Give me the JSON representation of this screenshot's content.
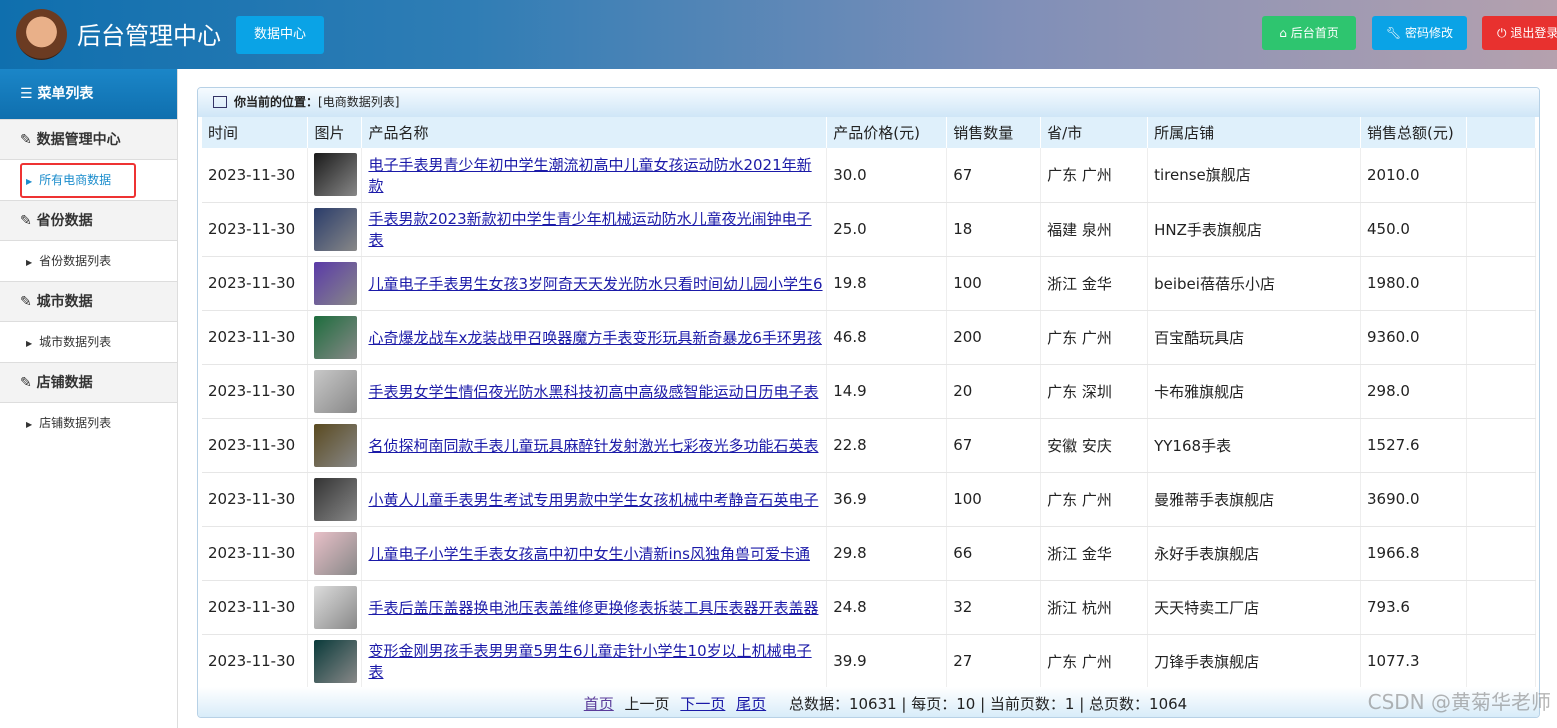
{
  "header": {
    "title": "后台管理中心",
    "data_center": "数据中心",
    "buttons": [
      {
        "label": "后台首页",
        "icon": "home-icon",
        "color": "#2ec56f"
      },
      {
        "label": "密码修改",
        "icon": "wrench-icon",
        "color": "#0aa3e6"
      },
      {
        "label": "退出登录",
        "icon": "power-icon",
        "color": "#e8312f"
      }
    ]
  },
  "sidebar": {
    "title": "菜单列表",
    "groups": [
      {
        "label": "数据管理中心",
        "item": "所有电商数据"
      },
      {
        "label": "省份数据",
        "item": "省份数据列表"
      },
      {
        "label": "城市数据",
        "item": "城市数据列表"
      },
      {
        "label": "店铺数据",
        "item": "店铺数据列表"
      }
    ]
  },
  "breadcrumb": {
    "label": "你当前的位置：",
    "value": "[电商数据列表]"
  },
  "table": {
    "columns": [
      "时间",
      "图片",
      "产品名称",
      "产品价格(元)",
      "销售数量",
      "省/市",
      "所属店铺",
      "销售总额(元)"
    ],
    "rows": [
      [
        "2023-11-30",
        "电子手表男青少年初中学生潮流初高中儿童女孩运动防水2021年新款",
        "30.0",
        "67",
        "广东 广州",
        "tirense旗舰店",
        "2010.0"
      ],
      [
        "2023-11-30",
        "手表男款2023新款初中学生青少年机械运动防水儿童夜光闹钟电子表",
        "25.0",
        "18",
        "福建 泉州",
        "HNZ手表旗舰店",
        "450.0"
      ],
      [
        "2023-11-30",
        "儿童电子手表男生女孩3岁阿奇天天发光防水只看时间幼儿园小学生6",
        "19.8",
        "100",
        "浙江 金华",
        "beibei蓓蓓乐小店",
        "1980.0"
      ],
      [
        "2023-11-30",
        "心奇爆龙战车x龙装战甲召唤器魔方手表变形玩具新奇暴龙6手环男孩",
        "46.8",
        "200",
        "广东 广州",
        "百宝酷玩具店",
        "9360.0"
      ],
      [
        "2023-11-30",
        "手表男女学生情侣夜光防水黑科技初高中高级感智能运动日历电子表",
        "14.9",
        "20",
        "广东 深圳",
        "卡布雅旗舰店",
        "298.0"
      ],
      [
        "2023-11-30",
        "名侦探柯南同款手表儿童玩具麻醉针发射激光七彩夜光多功能石英表",
        "22.8",
        "67",
        "安徽 安庆",
        "YY168手表",
        "1527.6"
      ],
      [
        "2023-11-30",
        "小黄人儿童手表男生考试专用男款中学生女孩机械中考静音石英电子",
        "36.9",
        "100",
        "广东 广州",
        "曼雅蒂手表旗舰店",
        "3690.0"
      ],
      [
        "2023-11-30",
        "儿童电子小学生手表女孩高中初中女生小清新ins风独角兽可爱卡通",
        "29.8",
        "66",
        "浙江 金华",
        "永好手表旗舰店",
        "1966.8"
      ],
      [
        "2023-11-30",
        "手表后盖压盖器换电池压表盖维修更换修表拆装工具压表器开表盖器",
        "24.8",
        "32",
        "浙江 杭州",
        "天天特卖工厂店",
        "793.6"
      ],
      [
        "2023-11-30",
        "变形金刚男孩手表男男童5男生6儿童走针小学生10岁以上机械电子表",
        "39.9",
        "27",
        "广东 广州",
        "刀锋手表旗舰店",
        "1077.3"
      ]
    ]
  },
  "pager": {
    "first": "首页",
    "prev": "上一页",
    "next": "下一页",
    "last": "尾页",
    "total": "总数据：10631 | 每页：10 | 当前页数：1 | 总页数：1064"
  },
  "watermark": "CSDN @黄菊华老师"
}
